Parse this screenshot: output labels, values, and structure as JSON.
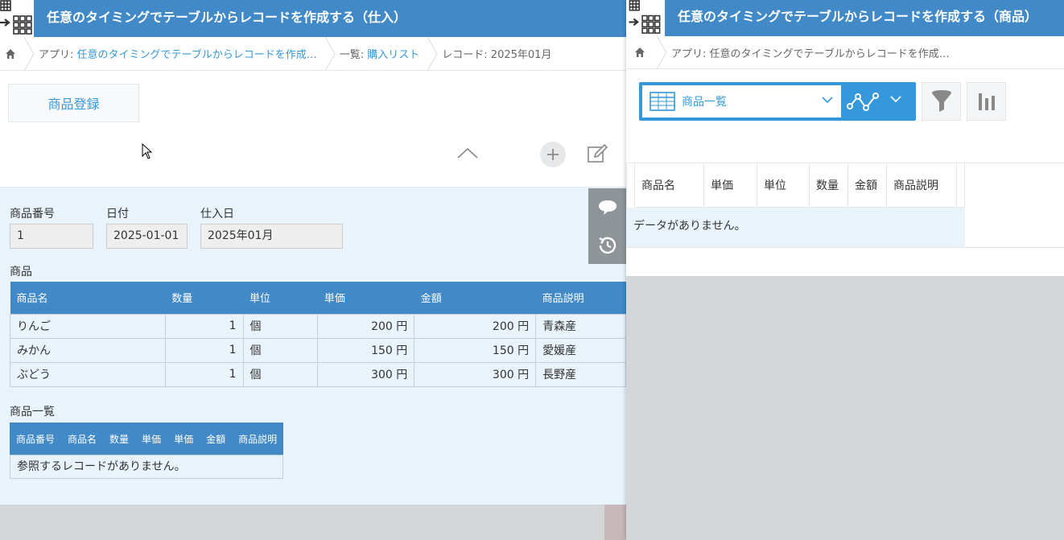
{
  "colors": {
    "accent": "#4189c7",
    "link": "#3498db",
    "panel_bg": "#e9f3fb"
  },
  "left": {
    "title": "任意のタイミングでテーブルからレコードを作成する（仕入）",
    "breadcrumb": {
      "app_prefix": "アプリ: ",
      "app_name": "任意のタイミングでテーブルからレコードを作成…",
      "list_prefix": "一覧: ",
      "list_name": "購入リスト",
      "record": "レコード: 2025年01月"
    },
    "register_button": "商品登録",
    "fields": {
      "product_no": {
        "label": "商品番号",
        "value": "1"
      },
      "date": {
        "label": "日付",
        "value": "2025-01-01"
      },
      "purchase_day": {
        "label": "仕入日",
        "value": "2025年01月"
      }
    },
    "subtable": {
      "label": "商品",
      "headers": [
        "商品名",
        "数量",
        "単位",
        "単価",
        "金額",
        "商品説明"
      ],
      "rows": [
        [
          "りんご",
          "1",
          "個",
          "200 円",
          "200 円",
          "青森産"
        ],
        [
          "みかん",
          "1",
          "個",
          "150 円",
          "150 円",
          "愛媛産"
        ],
        [
          "ぶどう",
          "1",
          "個",
          "300 円",
          "300 円",
          "長野産"
        ]
      ]
    },
    "reference": {
      "label": "商品一覧",
      "headers": [
        "商品番号",
        "商品名",
        "数量",
        "単価",
        "単価",
        "金額",
        "商品説明"
      ],
      "empty": "参照するレコードがありません。"
    }
  },
  "right": {
    "title": "任意のタイミングでテーブルからレコードを作成する（商品）",
    "breadcrumb": {
      "app_prefix": "アプリ: ",
      "app_name": "任意のタイミングでテーブルからレコードを作成…"
    },
    "view_name": "商品一覧",
    "list": {
      "headers": [
        "商品名",
        "単価",
        "単位",
        "数量",
        "金額",
        "商品説明"
      ],
      "empty": "データがありません。"
    }
  }
}
